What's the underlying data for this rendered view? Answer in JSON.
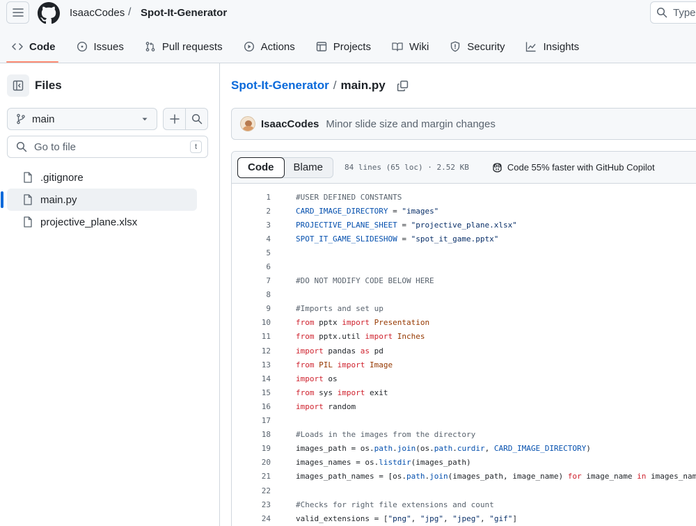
{
  "header": {
    "owner": "IsaacCodes",
    "separator": "/",
    "repo": "Spot-It-Generator",
    "search_placeholder": "Type"
  },
  "tabs": [
    {
      "label": "Code",
      "icon": "code-icon",
      "selected": true
    },
    {
      "label": "Issues",
      "icon": "issue-opened-icon"
    },
    {
      "label": "Pull requests",
      "icon": "git-pull-request-icon"
    },
    {
      "label": "Actions",
      "icon": "play-icon"
    },
    {
      "label": "Projects",
      "icon": "table-icon"
    },
    {
      "label": "Wiki",
      "icon": "book-icon"
    },
    {
      "label": "Security",
      "icon": "shield-icon"
    },
    {
      "label": "Insights",
      "icon": "graph-icon"
    }
  ],
  "sidebar": {
    "title": "Files",
    "branch": "main",
    "goto_placeholder": "Go to file",
    "goto_shortcut": "t",
    "files": [
      {
        "name": ".gitignore",
        "active": false
      },
      {
        "name": "main.py",
        "active": true
      },
      {
        "name": "projective_plane.xlsx",
        "active": false
      }
    ]
  },
  "main": {
    "path_repo": "Spot-It-Generator",
    "path_sep": "/",
    "path_file": "main.py",
    "commit_author": "IsaacCodes",
    "commit_message": "Minor slide size and margin changes",
    "view_tabs": [
      "Code",
      "Blame"
    ],
    "file_meta": "84 lines (65 loc) · 2.52 KB",
    "copilot_text": "Code 55% faster with GitHub Copilot"
  },
  "code_lines": [
    {
      "n": "1",
      "tokens": [
        [
          "c-com",
          "#USER DEFINED CONSTANTS"
        ]
      ]
    },
    {
      "n": "2",
      "tokens": [
        [
          "c-var",
          "CARD_IMAGE_DIRECTORY"
        ],
        [
          "c-txt",
          " = "
        ],
        [
          "c-str",
          "\"images\""
        ]
      ]
    },
    {
      "n": "3",
      "tokens": [
        [
          "c-var",
          "PROJECTIVE_PLANE_SHEET"
        ],
        [
          "c-txt",
          " = "
        ],
        [
          "c-str",
          "\"projective_plane.xlsx\""
        ]
      ]
    },
    {
      "n": "4",
      "tokens": [
        [
          "c-var",
          "SPOT_IT_GAME_SLIDESHOW"
        ],
        [
          "c-txt",
          " = "
        ],
        [
          "c-str",
          "\"spot_it_game.pptx\""
        ]
      ]
    },
    {
      "n": "5",
      "tokens": []
    },
    {
      "n": "6",
      "tokens": []
    },
    {
      "n": "7",
      "tokens": [
        [
          "c-com",
          "#DO NOT MODIFY CODE BELOW HERE"
        ]
      ]
    },
    {
      "n": "8",
      "tokens": []
    },
    {
      "n": "9",
      "tokens": [
        [
          "c-com",
          "#Imports and set up"
        ]
      ]
    },
    {
      "n": "10",
      "tokens": [
        [
          "c-kw",
          "from"
        ],
        [
          "c-txt",
          " pptx "
        ],
        [
          "c-kw",
          "import"
        ],
        [
          "c-txt",
          " "
        ],
        [
          "c-cls",
          "Presentation"
        ]
      ]
    },
    {
      "n": "11",
      "tokens": [
        [
          "c-kw",
          "from"
        ],
        [
          "c-txt",
          " pptx.util "
        ],
        [
          "c-kw",
          "import"
        ],
        [
          "c-txt",
          " "
        ],
        [
          "c-cls",
          "Inches"
        ]
      ]
    },
    {
      "n": "12",
      "tokens": [
        [
          "c-kw",
          "import"
        ],
        [
          "c-txt",
          " pandas "
        ],
        [
          "c-kw",
          "as"
        ],
        [
          "c-txt",
          " pd"
        ]
      ]
    },
    {
      "n": "13",
      "tokens": [
        [
          "c-kw",
          "from"
        ],
        [
          "c-txt",
          " "
        ],
        [
          "c-cls",
          "PIL"
        ],
        [
          "c-txt",
          " "
        ],
        [
          "c-kw",
          "import"
        ],
        [
          "c-txt",
          " "
        ],
        [
          "c-cls",
          "Image"
        ]
      ]
    },
    {
      "n": "14",
      "tokens": [
        [
          "c-kw",
          "import"
        ],
        [
          "c-txt",
          " os"
        ]
      ]
    },
    {
      "n": "15",
      "tokens": [
        [
          "c-kw",
          "from"
        ],
        [
          "c-txt",
          " sys "
        ],
        [
          "c-kw",
          "import"
        ],
        [
          "c-txt",
          " exit"
        ]
      ]
    },
    {
      "n": "16",
      "tokens": [
        [
          "c-kw",
          "import"
        ],
        [
          "c-txt",
          " random"
        ]
      ]
    },
    {
      "n": "17",
      "tokens": []
    },
    {
      "n": "18",
      "tokens": [
        [
          "c-com",
          "#Loads in the images from the directory"
        ]
      ]
    },
    {
      "n": "19",
      "tokens": [
        [
          "c-txt",
          "images_path = os."
        ],
        [
          "c-var",
          "path"
        ],
        [
          "c-txt",
          "."
        ],
        [
          "c-var",
          "join"
        ],
        [
          "c-txt",
          "(os."
        ],
        [
          "c-var",
          "path"
        ],
        [
          "c-txt",
          "."
        ],
        [
          "c-var",
          "curdir"
        ],
        [
          "c-txt",
          ", "
        ],
        [
          "c-var",
          "CARD_IMAGE_DIRECTORY"
        ],
        [
          "c-txt",
          ")"
        ]
      ]
    },
    {
      "n": "20",
      "tokens": [
        [
          "c-txt",
          "images_names = os."
        ],
        [
          "c-var",
          "listdir"
        ],
        [
          "c-txt",
          "(images_path)"
        ]
      ]
    },
    {
      "n": "21",
      "tokens": [
        [
          "c-txt",
          "images_path_names = [os."
        ],
        [
          "c-var",
          "path"
        ],
        [
          "c-txt",
          "."
        ],
        [
          "c-var",
          "join"
        ],
        [
          "c-txt",
          "(images_path, image_name) "
        ],
        [
          "c-kw",
          "for"
        ],
        [
          "c-txt",
          " image_name "
        ],
        [
          "c-kw",
          "in"
        ],
        [
          "c-txt",
          " images_nam"
        ]
      ]
    },
    {
      "n": "22",
      "tokens": []
    },
    {
      "n": "23",
      "tokens": [
        [
          "c-com",
          "#Checks for right file extensions and count"
        ]
      ]
    },
    {
      "n": "24",
      "tokens": [
        [
          "c-txt",
          "valid_extensions = ["
        ],
        [
          "c-str",
          "\"png\""
        ],
        [
          "c-txt",
          ", "
        ],
        [
          "c-str",
          "\"jpg\""
        ],
        [
          "c-txt",
          ", "
        ],
        [
          "c-str",
          "\"jpeg\""
        ],
        [
          "c-txt",
          ", "
        ],
        [
          "c-str",
          "\"gif\""
        ],
        [
          "c-txt",
          "]"
        ]
      ]
    }
  ]
}
